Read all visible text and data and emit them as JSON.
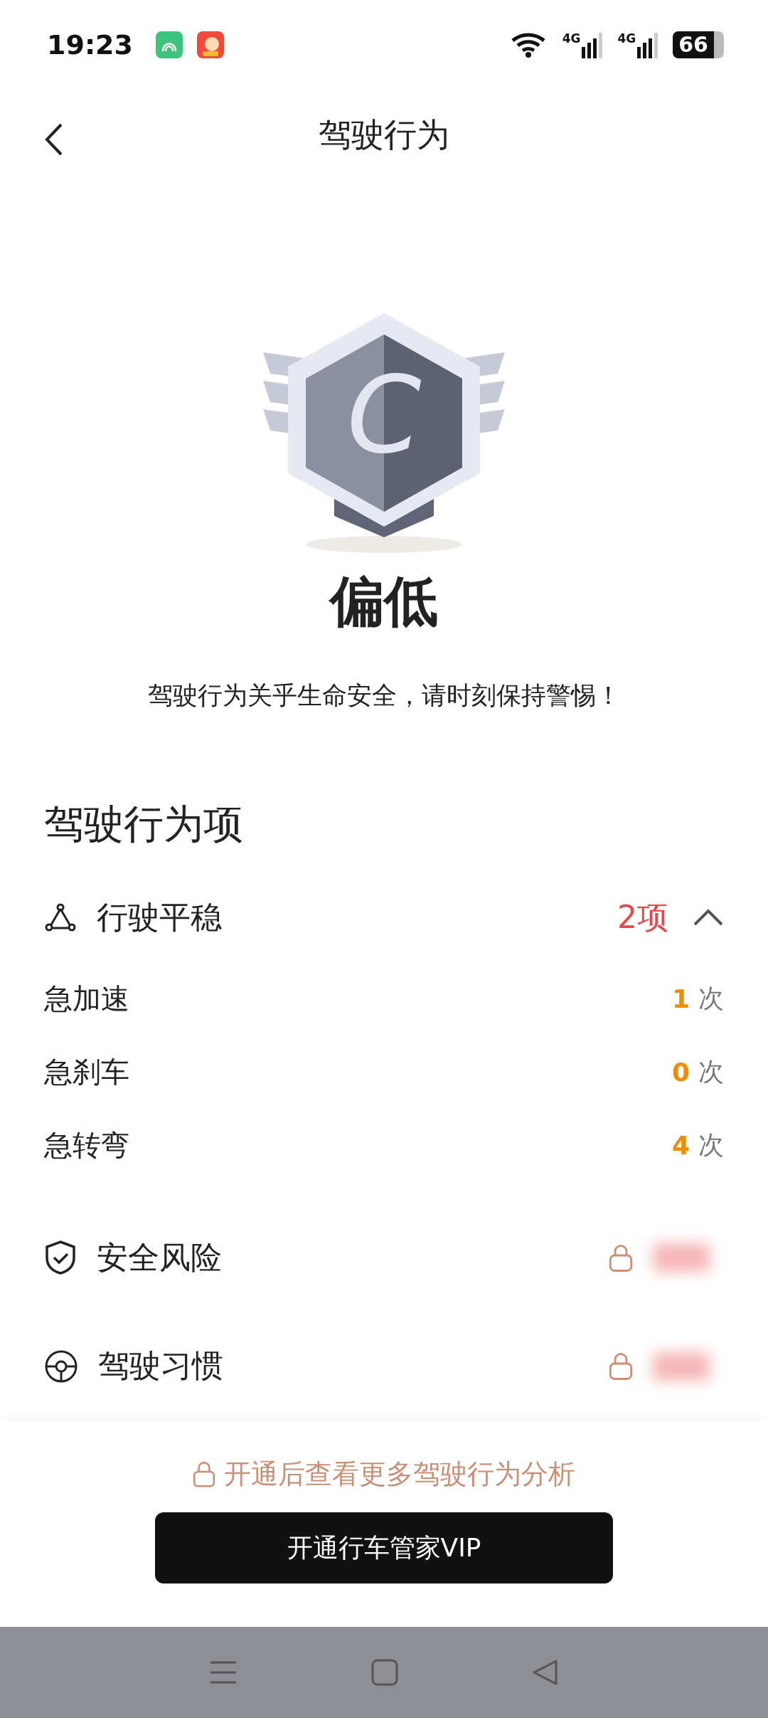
{
  "status_bar": {
    "time": "19:23",
    "network_1": "4G",
    "network_2": "4G",
    "battery": "66"
  },
  "header": {
    "title": "驾驶行为"
  },
  "grade": {
    "letter": "C",
    "label": "偏低",
    "message": "驾驶行为关乎生命安全，请时刻保持警惕！"
  },
  "section": {
    "title": "驾驶行为项"
  },
  "categories": [
    {
      "kind": "triangle",
      "name": "行驶平稳",
      "locked": false,
      "count": "2项",
      "expanded": true,
      "items": [
        {
          "name": "急加速",
          "count": "1",
          "unit": "次"
        },
        {
          "name": "急刹车",
          "count": "0",
          "unit": "次"
        },
        {
          "name": "急转弯",
          "count": "4",
          "unit": "次"
        }
      ]
    },
    {
      "kind": "shield",
      "name": "安全风险",
      "locked": true
    },
    {
      "kind": "wheel",
      "name": "驾驶习惯",
      "locked": true
    }
  ],
  "paywall": {
    "hint": "开通后查看更多驾驶行为分析",
    "button": "开通行车管家VIP"
  }
}
